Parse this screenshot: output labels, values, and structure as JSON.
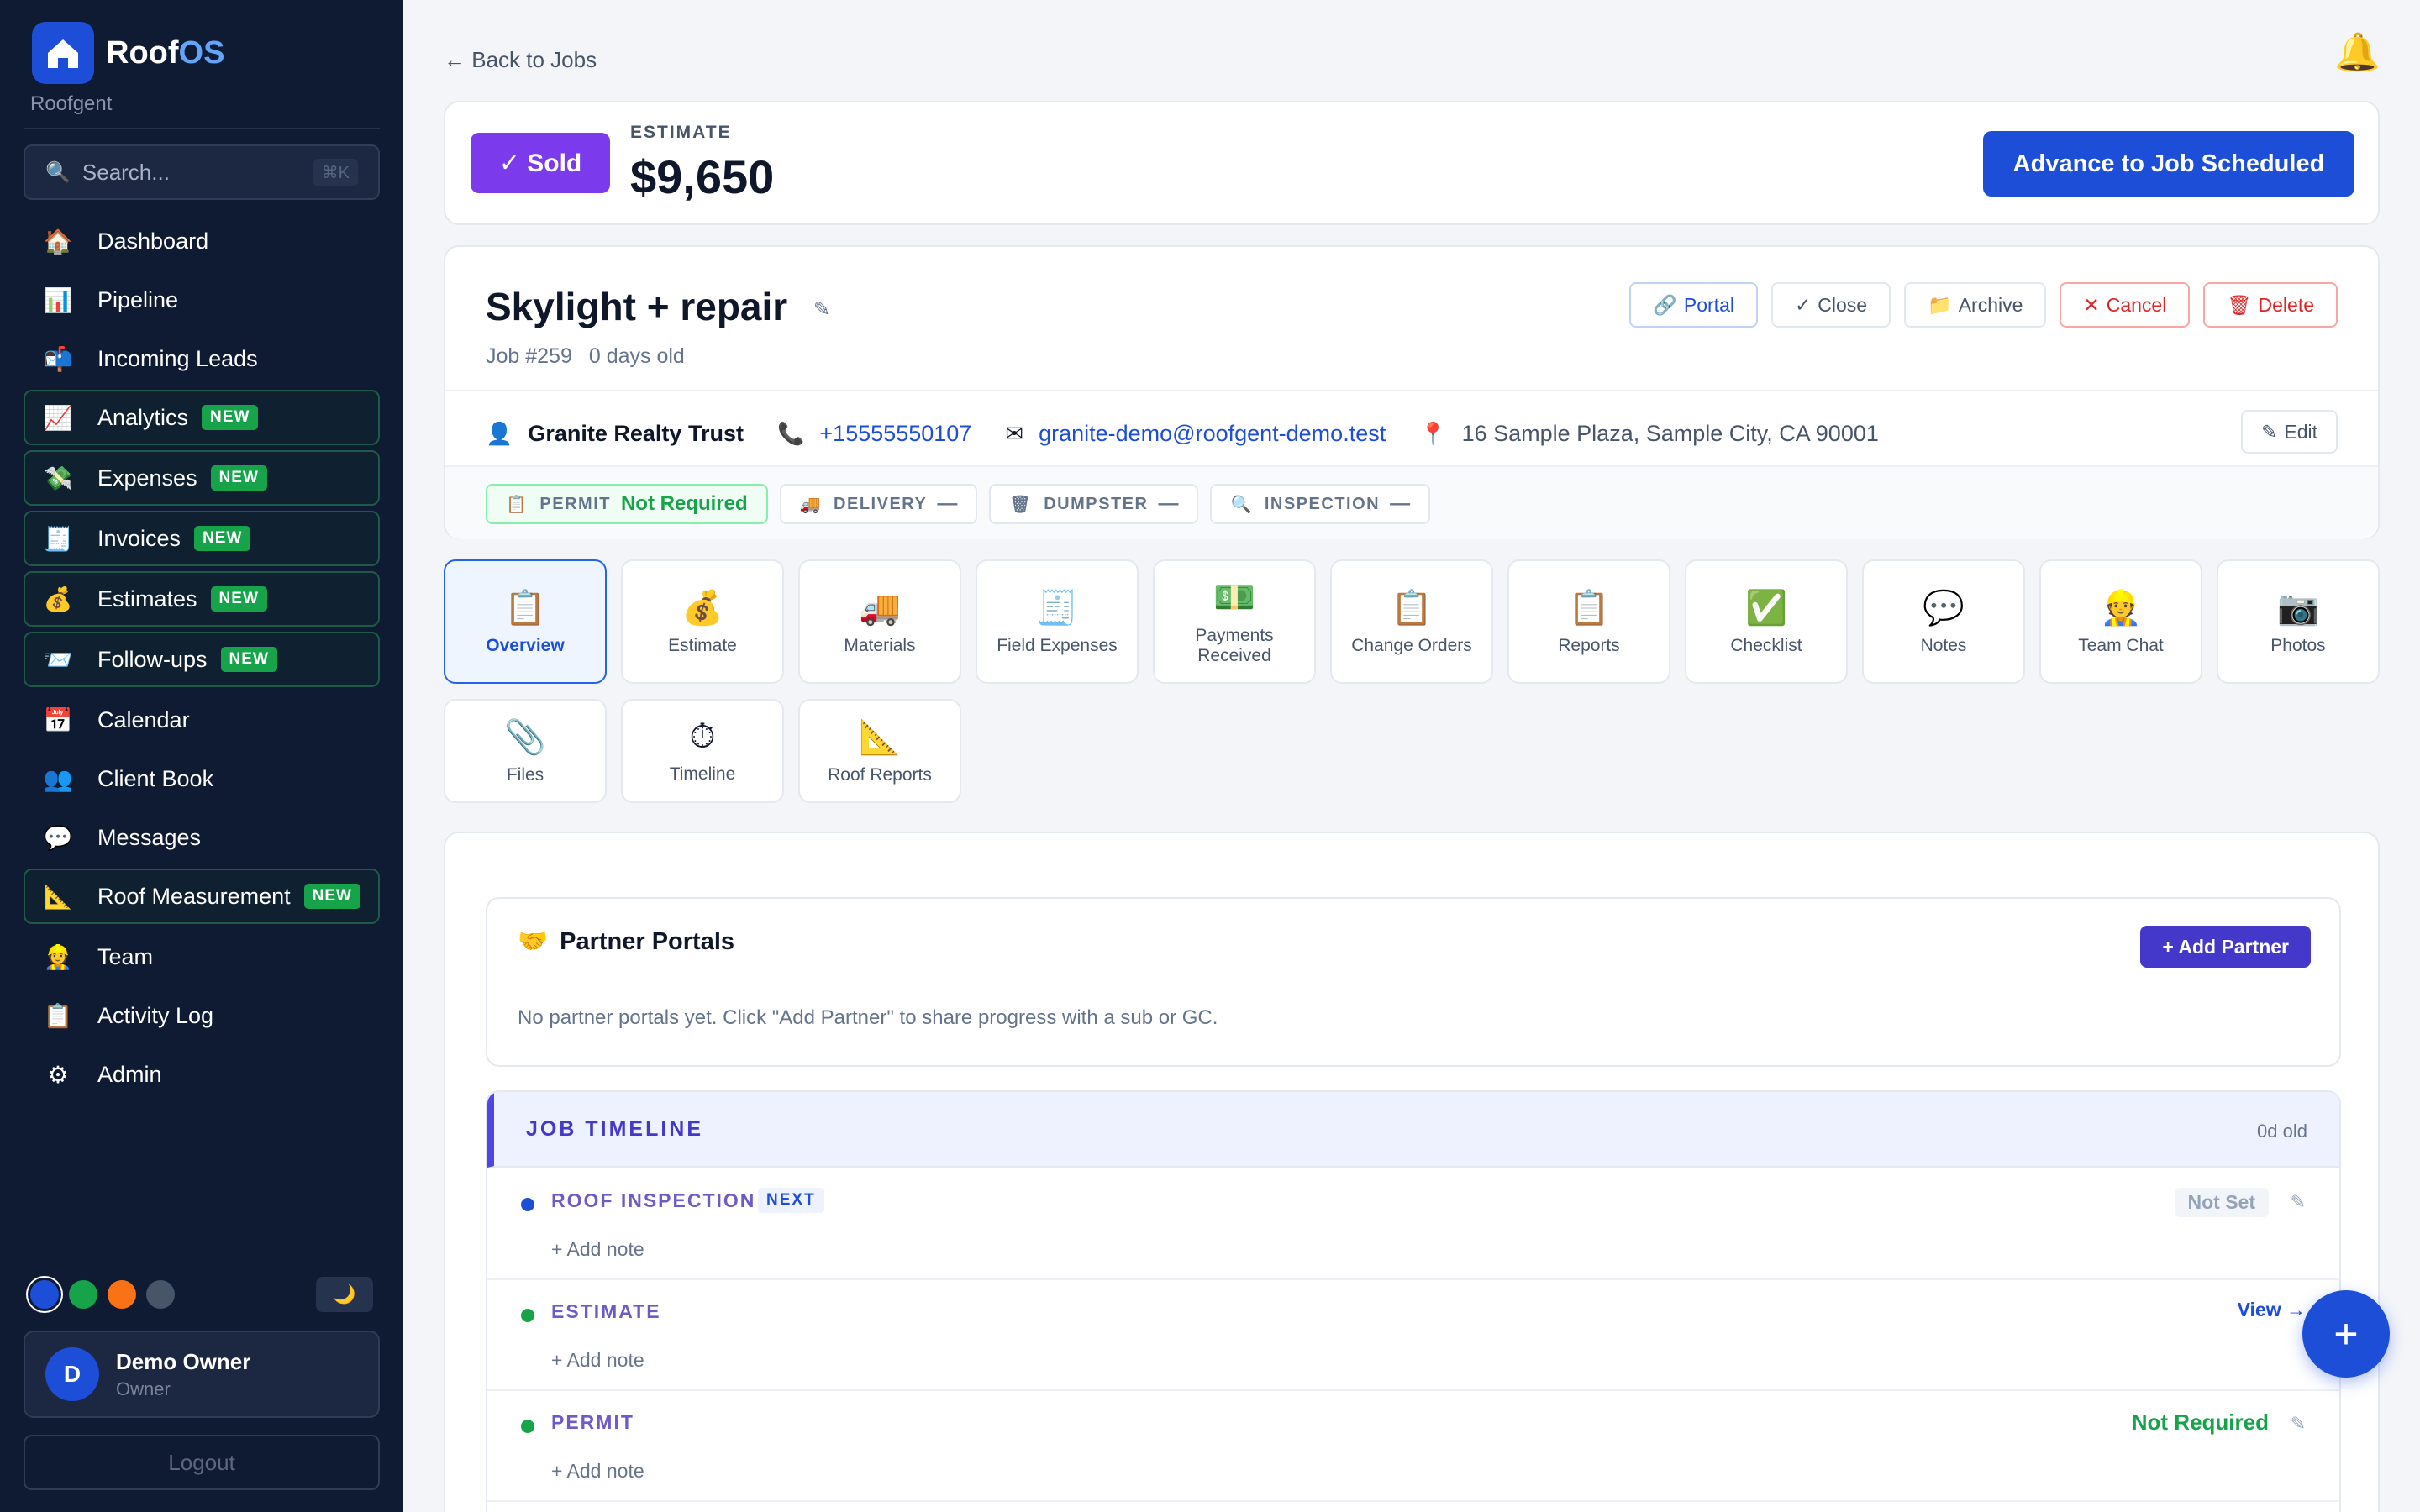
{
  "brand": {
    "name_main": "Roof",
    "name_accent": "OS",
    "subtitle": "Roofgent"
  },
  "search": {
    "placeholder": "Search...",
    "shortcut": "⌘K"
  },
  "nav": [
    {
      "label": "Dashboard",
      "icon": "🏠",
      "new": false
    },
    {
      "label": "Pipeline",
      "icon": "📊",
      "new": false
    },
    {
      "label": "Incoming Leads",
      "icon": "📬",
      "new": false
    },
    {
      "label": "Analytics",
      "icon": "📈",
      "new": true
    },
    {
      "label": "Expenses",
      "icon": "💸",
      "new": true
    },
    {
      "label": "Invoices",
      "icon": "🧾",
      "new": true
    },
    {
      "label": "Estimates",
      "icon": "💰",
      "new": true
    },
    {
      "label": "Follow-ups",
      "icon": "📨",
      "new": true
    },
    {
      "label": "Calendar",
      "icon": "📅",
      "new": false
    },
    {
      "label": "Client Book",
      "icon": "👥",
      "new": false
    },
    {
      "label": "Messages",
      "icon": "💬",
      "new": false
    },
    {
      "label": "Roof Measurement",
      "icon": "📐",
      "new": true
    },
    {
      "label": "Team",
      "icon": "👷",
      "new": false
    },
    {
      "label": "Activity Log",
      "icon": "📋",
      "new": false
    },
    {
      "label": "Admin",
      "icon": "⚙",
      "new": false
    }
  ],
  "new_badge": "NEW",
  "theme_colors": [
    "#1d4ed8",
    "#16a34a",
    "#f97316",
    "#475569"
  ],
  "theme_toggle": "🌙",
  "user": {
    "initial": "D",
    "name": "Demo Owner",
    "role": "Owner"
  },
  "logout_label": "Logout",
  "back_label": "← Back to Jobs",
  "status": {
    "badge": "✓ Sold",
    "estimate_label": "ESTIMATE",
    "estimate_value": "$9,650",
    "advance_label": "Advance to Job Scheduled"
  },
  "job": {
    "title": "Skylight + repair",
    "number": "Job #259",
    "age": "0 days old",
    "actions": {
      "portal": "Portal",
      "close": "Close",
      "archive": "Archive",
      "cancel": "Cancel",
      "delete": "Delete"
    },
    "client": "Granite Realty Trust",
    "phone": "+15555550107",
    "email": "granite-demo@roofgent-demo.test",
    "address": "16 Sample Plaza, Sample City, CA 90001",
    "edit_label": "Edit"
  },
  "chips": [
    {
      "label": "PERMIT",
      "value": "Not Required",
      "icon": "📋"
    },
    {
      "label": "DELIVERY",
      "value": "—",
      "icon": "🚚"
    },
    {
      "label": "DUMPSTER",
      "value": "—",
      "icon": "🗑"
    },
    {
      "label": "INSPECTION",
      "value": "—",
      "icon": "🔍"
    }
  ],
  "tabs": [
    {
      "label": "Overview",
      "icon": "📋"
    },
    {
      "label": "Estimate",
      "icon": "💰"
    },
    {
      "label": "Materials",
      "icon": "🚚"
    },
    {
      "label": "Field Expenses",
      "icon": "🧾"
    },
    {
      "label": "Payments Received",
      "icon": "💵"
    },
    {
      "label": "Change Orders",
      "icon": "📋"
    },
    {
      "label": "Reports",
      "icon": "📋"
    },
    {
      "label": "Checklist",
      "icon": "✅"
    },
    {
      "label": "Notes",
      "icon": "💬"
    },
    {
      "label": "Team Chat",
      "icon": "👷"
    },
    {
      "label": "Photos",
      "icon": "📷"
    },
    {
      "label": "Files",
      "icon": "📎"
    },
    {
      "label": "Timeline",
      "icon": "⏱"
    },
    {
      "label": "Roof Reports",
      "icon": "📐"
    }
  ],
  "partner": {
    "icon": "🤝",
    "title": "Partner Portals",
    "add_label": "+ Add Partner",
    "empty": "No partner portals yet. Click \"Add Partner\" to share progress with a sub or GC."
  },
  "timeline": {
    "title": "JOB TIMELINE",
    "age": "0d old",
    "add_note": "+ Add note",
    "rows": [
      {
        "name": "ROOF INSPECTION",
        "tag": "NEXT",
        "status": "Not Set",
        "dot": "#1d4ed8"
      },
      {
        "name": "ESTIMATE",
        "tag": "",
        "status": "View →",
        "dot": "#16a34a"
      },
      {
        "name": "PERMIT",
        "tag": "",
        "status": "Not Required",
        "dot": "#16a34a"
      }
    ]
  },
  "fab_label": "+",
  "bell_icon": "🔔"
}
